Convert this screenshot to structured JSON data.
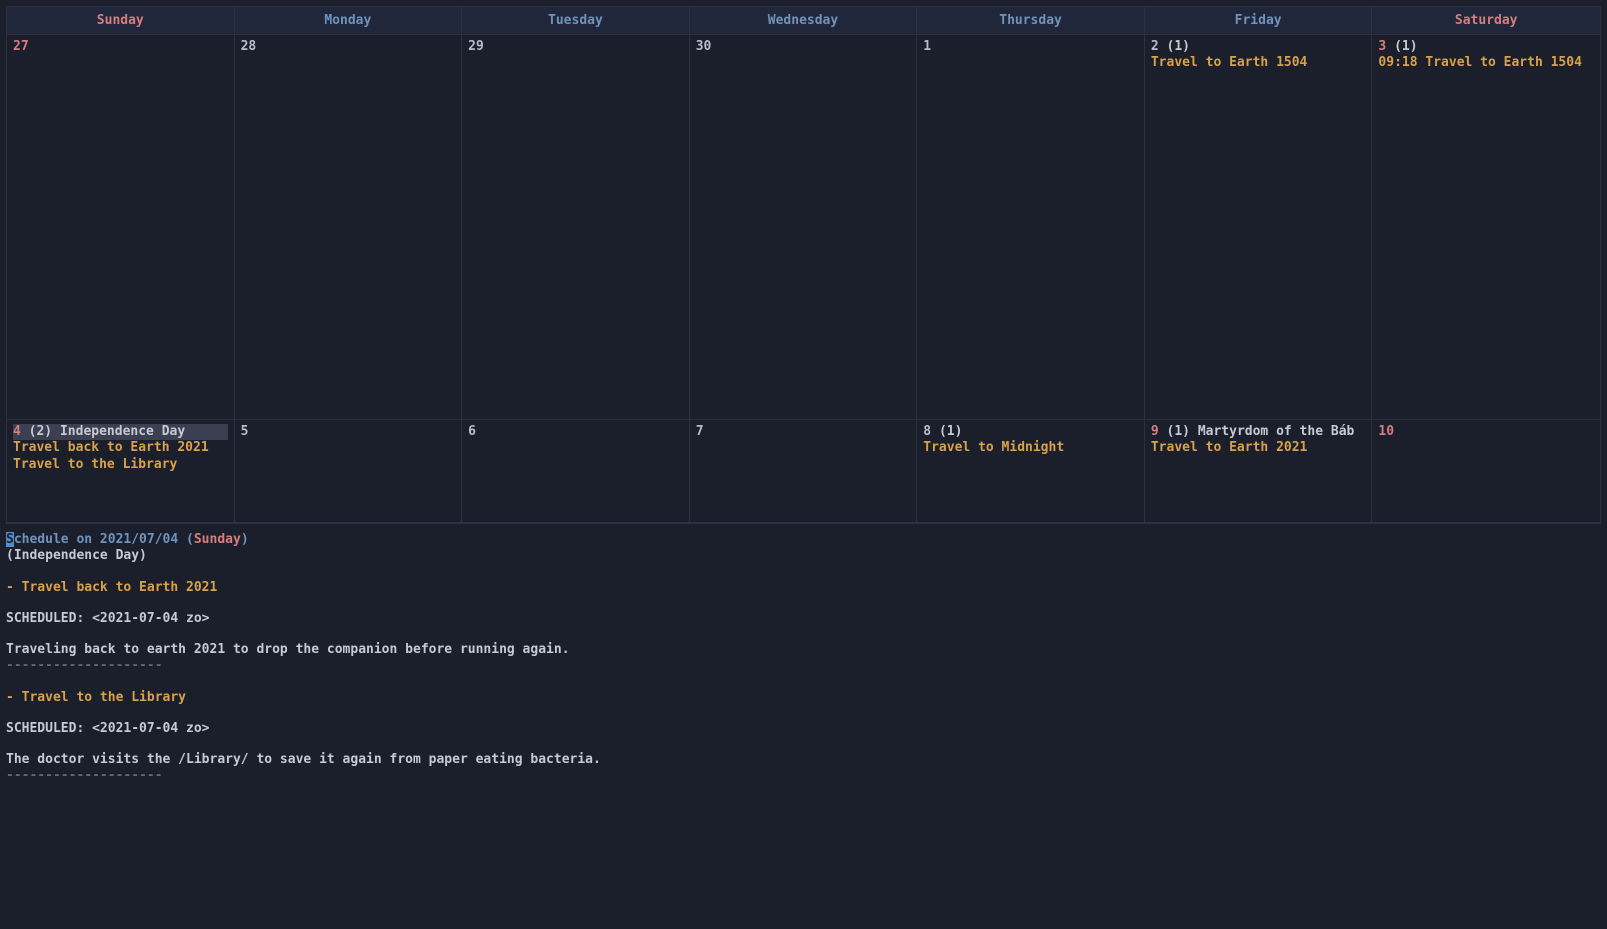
{
  "colors": {
    "bg": "#1b1f2b",
    "grid": "#2c3040",
    "weekday": "#6f93bd",
    "weekend": "#d77e7e",
    "event": "#d9a24a",
    "sep": "#5f6476"
  },
  "header": {
    "days": [
      "Sunday",
      "Monday",
      "Tuesday",
      "Wednesday",
      "Thursday",
      "Friday",
      "Saturday"
    ],
    "weekendIdx": [
      0,
      6
    ]
  },
  "week1": {
    "sun": {
      "num": "27"
    },
    "mon": {
      "num": "28"
    },
    "tue": {
      "num": "29"
    },
    "wed": {
      "num": "30"
    },
    "thu": {
      "num": "1"
    },
    "fri": {
      "num": "2",
      "count": "(1)",
      "events": [
        "Travel to Earth 1504"
      ]
    },
    "sat": {
      "num": "3",
      "count": "(1)",
      "events": [
        "09:18 Travel to Earth 1504"
      ]
    }
  },
  "week2": {
    "sun": {
      "num": "4",
      "count": "(2)",
      "holiday": "Independence Day",
      "events": [
        "Travel back to Earth 2021",
        "Travel to the Library"
      ],
      "selected": true
    },
    "mon": {
      "num": "5"
    },
    "tue": {
      "num": "6"
    },
    "wed": {
      "num": "7"
    },
    "thu": {
      "num": "8",
      "count": "(1)",
      "events": [
        "Travel to Midnight"
      ]
    },
    "fri": {
      "num": "9",
      "count": "(1)",
      "holiday": "Martyrdom of the Báb",
      "events": [
        "Travel to Earth 2021"
      ]
    },
    "sat": {
      "num": "10"
    }
  },
  "schedule": {
    "title_prefix_first": "S",
    "title_prefix_rest": "chedule on ",
    "title_date": "2021/07/04",
    "title_open": " (",
    "title_day": "Sunday",
    "title_close": ")",
    "holiday": "(Independence Day)",
    "entries": [
      {
        "head": "- Travel back to Earth 2021",
        "sched": "   SCHEDULED: <2021-07-04 zo>",
        "body": "   Traveling back to earth 2021 to drop the companion before running again."
      },
      {
        "head": "- Travel to the Library",
        "sched": "   SCHEDULED: <2021-07-04 zo>",
        "body": "   The doctor visits the /Library/ to save it again from paper eating bacteria."
      }
    ],
    "sep": "--------------------"
  }
}
